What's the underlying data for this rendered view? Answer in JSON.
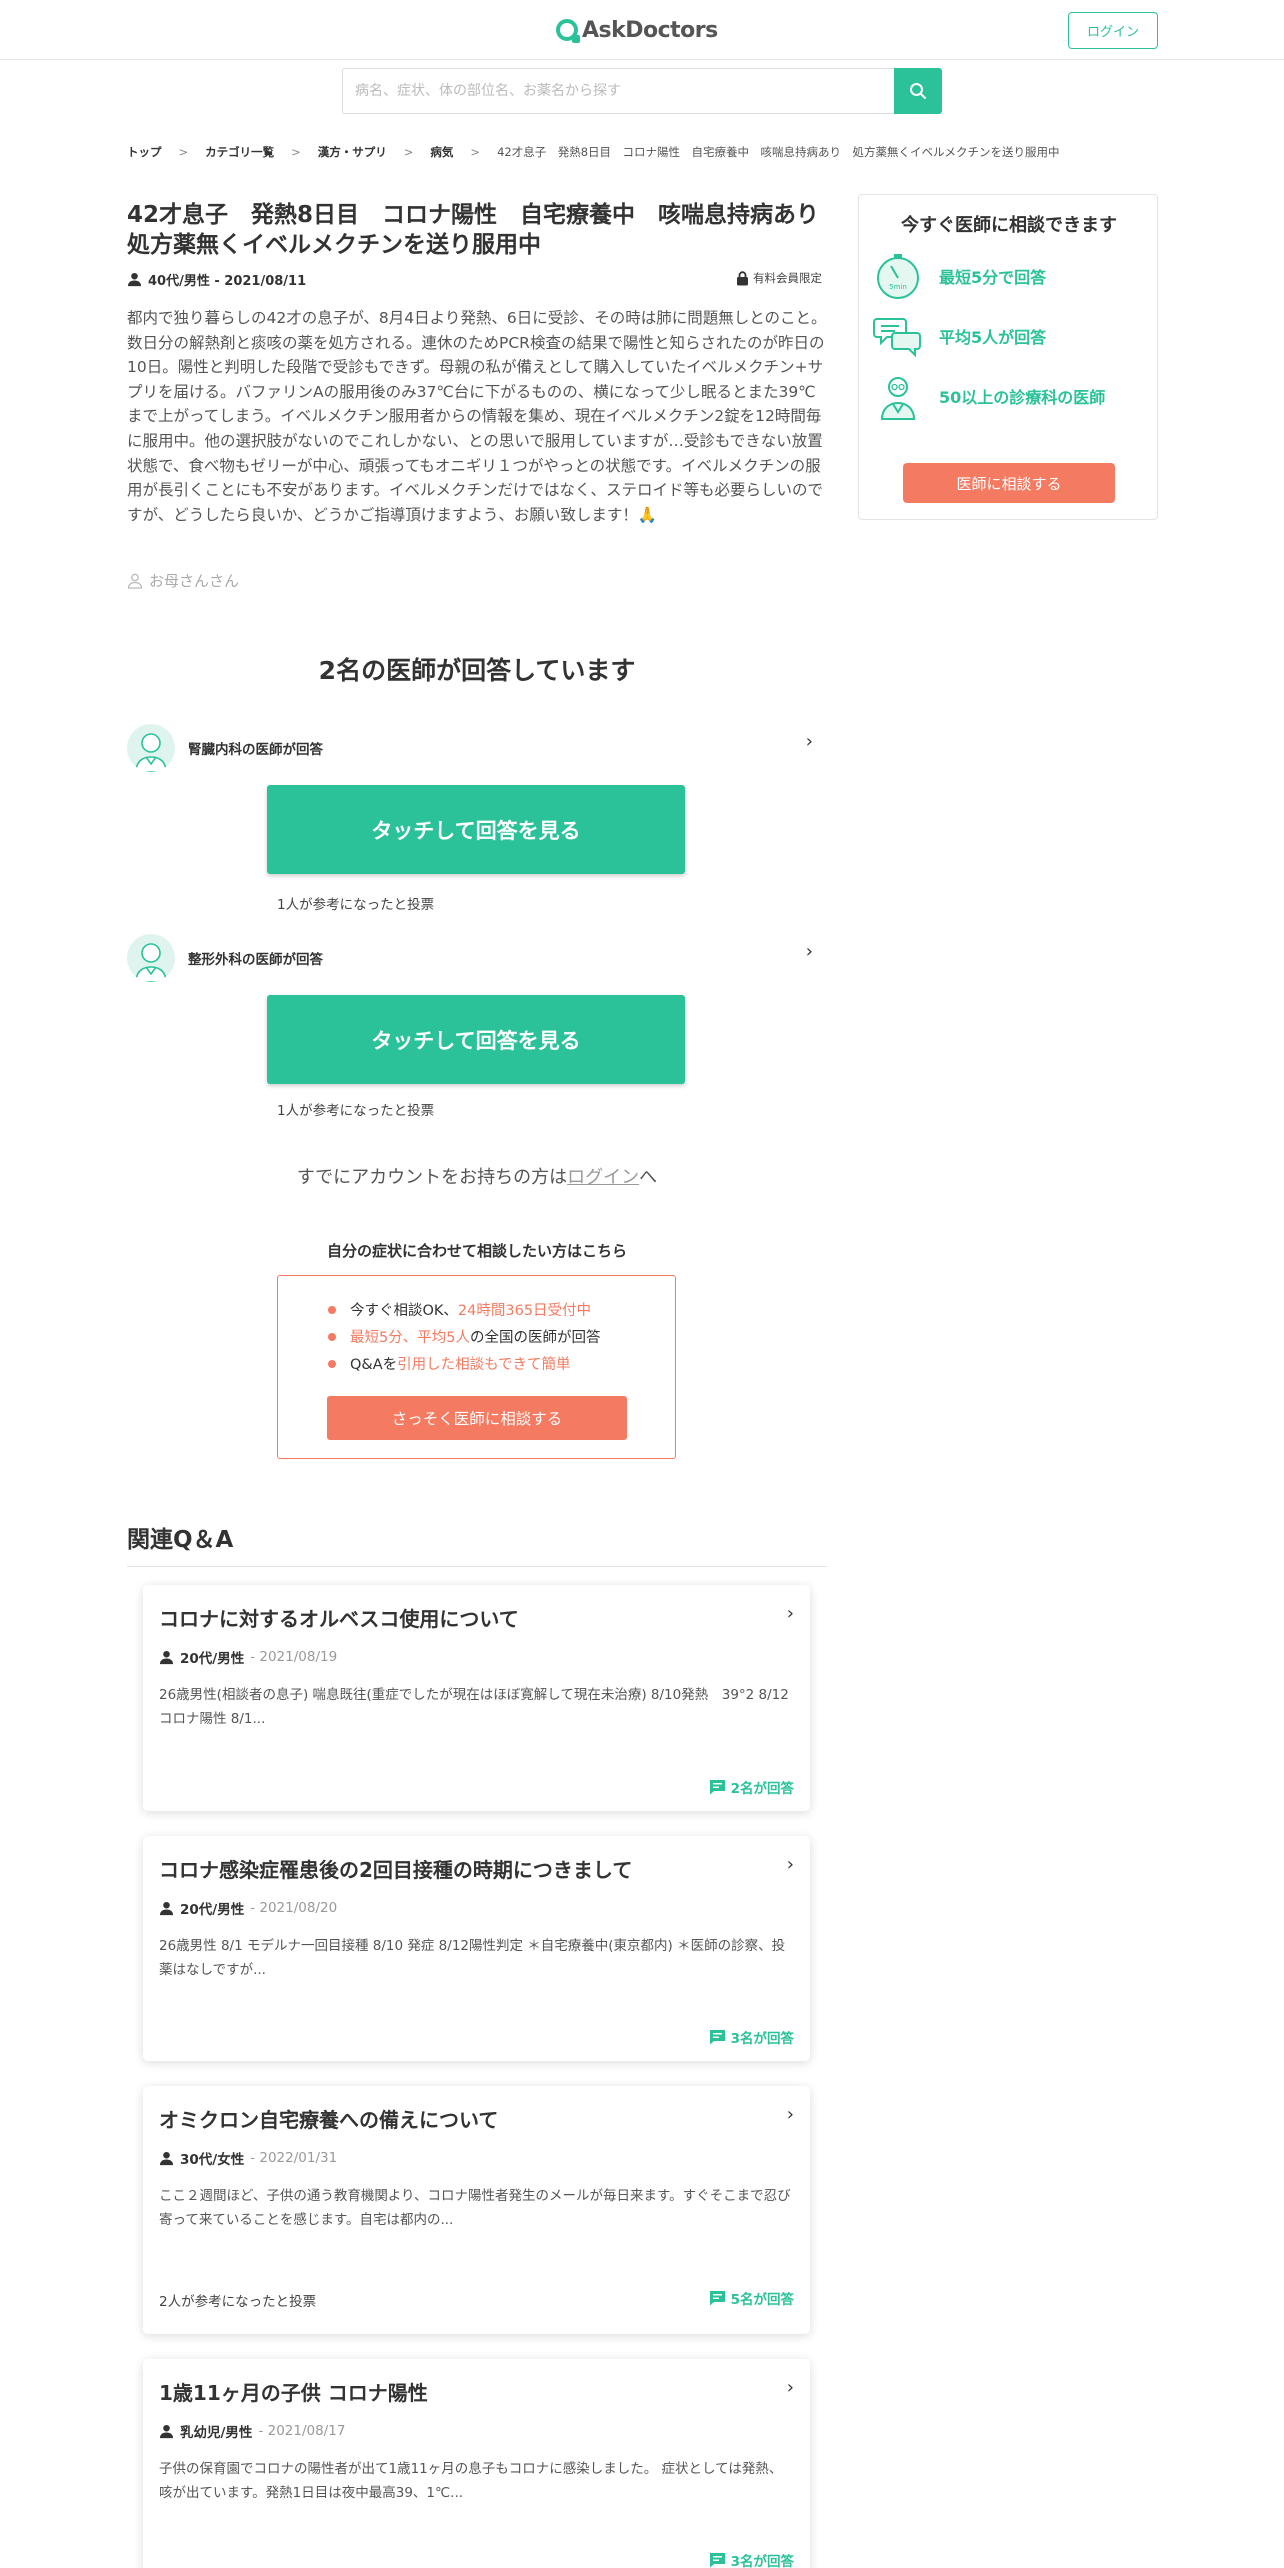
{
  "header": {
    "logo_text": "AskDoctors",
    "login_label": "ログイン"
  },
  "search": {
    "placeholder": "病名、症状、体の部位名、お薬名から探す"
  },
  "breadcrumb": {
    "items": [
      "トップ",
      "カテゴリ一覧",
      "漢方・サプリ",
      "病気"
    ],
    "current": "42才息子　発熱8日目　コロナ陽性　自宅療養中　咳喘息持病あり　処方薬無くイベルメクチンを送り服用中"
  },
  "question": {
    "title": "42才息子　発熱8日目　コロナ陽性　自宅療養中　咳喘息持病あり　処方薬無くイベルメクチンを送り服用中",
    "meta": "40代/男性 - 2021/08/11",
    "premium_label": "有料会員限定",
    "body": "都内で独り暮らしの42才の息子が、8月4日より発熱、6日に受診、その時は肺に問題無しとのこと。数日分の解熱剤と痰咳の薬を処方される。連休のためPCR検査の結果で陽性と知らされたのが昨日の10日。陽性と判明した段階で受診もできず。母親の私が備えとして購入していたイベルメクチン+サプリを届ける。バファリンAの服用後のみ37℃台に下がるものの、横になって少し眠るとまた39℃まで上がってしまう。イベルメクチン服用者からの情報を集め、現在イベルメクチン2錠を12時間毎に服用中。他の選択肢がないのでこれしかない、との思いで服用していますが…受診もできない放置状態で、食べ物もゼリーが中心、頑張ってもオニギリ１つがやっとの状態です。イベルメクチンの服用が長引くことにも不安があります。イベルメクチンだけではなく、ステロイド等も必要らしいのですが、どうしたら良いか、どうかご指導頂けますよう、お願い致します！🙏",
    "author": "お母さんさん"
  },
  "sidebar": {
    "title": "今すぐ医師に相談できます",
    "features": [
      "最短5分で回答",
      "平均5人が回答",
      "50以上の診療科の医師"
    ],
    "cta_label": "医師に相談する"
  },
  "answers": {
    "heading": "2名の医師が回答しています",
    "items": [
      {
        "doctor": "腎臓内科の医師が回答",
        "button": "タッチして回答を見る",
        "votes": "1人が参考になったと投票"
      },
      {
        "doctor": "整形外科の医師が回答",
        "button": "タッチして回答を見る",
        "votes": "1人が参考になったと投票"
      }
    ]
  },
  "account": {
    "prefix": "すでにアカウントをお持ちの方は",
    "link": "ログイン",
    "suffix": "へ"
  },
  "promo": {
    "heading": "自分の症状に合わせて相談したい方はこちら",
    "line1_a": "今すぐ相談OK、",
    "line1_b": "24時間365日受付中",
    "line2_a": "最短5分、平均5人",
    "line2_b": "の全国の医師が回答",
    "line3_a": "Q&Aを",
    "line3_b": "引用した相談もできて簡単",
    "cta_label": "さっそく医師に相談する"
  },
  "related": {
    "heading": "関連Q＆A",
    "items": [
      {
        "title": "コロナに対するオルベスコ使用について",
        "user": "20代/男性",
        "date": "- 2021/08/19",
        "body": "26歳男性(相談者の息子) 喘息既往(重症でしたが現在はほぼ寛解して現在未治療) 8/10発熱　39°2 8/12コロナ陽性 8/1...",
        "votes": "",
        "answers": "2名が回答"
      },
      {
        "title": "コロナ感染症罹患後の2回目接種の時期につきまして",
        "user": "20代/男性",
        "date": "- 2021/08/20",
        "body": "26歳男性 8/1 モデルナ一回目接種 8/10 発症 8/12陽性判定 ＊自宅療養中(東京都内) ＊医師の診察、投薬はなしですが...",
        "votes": "",
        "answers": "3名が回答"
      },
      {
        "title": "オミクロン自宅療養への備えについて",
        "user": "30代/女性",
        "date": "- 2022/01/31",
        "body": "ここ２週間ほど、子供の通う教育機関より、コロナ陽性者発生のメールが毎日来ます。すぐそこまで忍び寄って来ていることを感じます。自宅は都内の...",
        "votes": "2人が参考になったと投票",
        "answers": "5名が回答"
      },
      {
        "title": "1歳11ヶ月の子供 コロナ陽性",
        "user": "乳幼児/男性",
        "date": "- 2021/08/17",
        "body": "子供の保育園でコロナの陽性者が出て1歳11ヶ月の息子もコロナに感染しました。 症状としては発熱、咳が出ています。発熱1日目は夜中最高39、1℃...",
        "votes": "",
        "answers": "3名が回答"
      }
    ]
  },
  "colors": {
    "accent": "#2bc29a",
    "cta": "#f47b62"
  }
}
